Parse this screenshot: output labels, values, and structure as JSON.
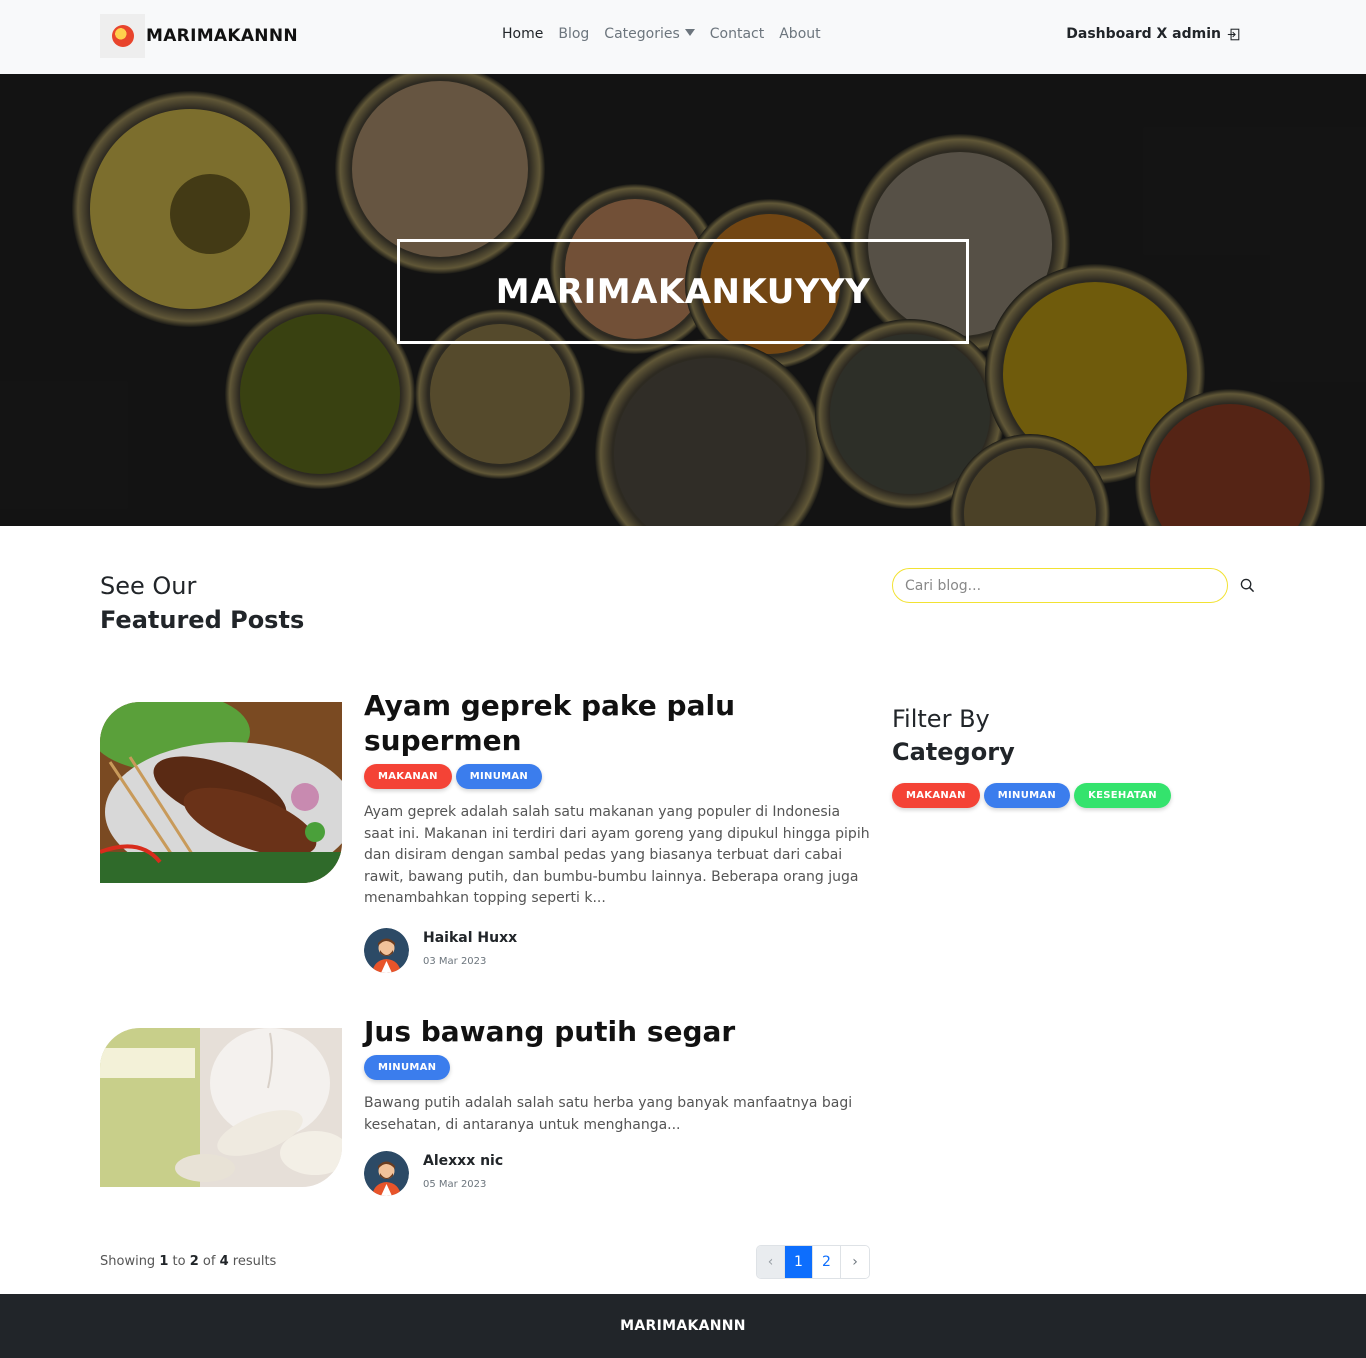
{
  "navbar": {
    "brand": "MARIMAKANNN",
    "links": [
      {
        "label": "Home",
        "active": true
      },
      {
        "label": "Blog",
        "active": false
      },
      {
        "label": "Categories",
        "active": false
      },
      {
        "label": "Contact",
        "active": false
      },
      {
        "label": "About",
        "active": false
      }
    ],
    "user_label": "Dashboard X admin"
  },
  "hero": {
    "title": "MARIMAKANKUYYY"
  },
  "featured": {
    "line1": "See Our",
    "line2": "Featured Posts"
  },
  "posts": [
    {
      "title": "Ayam geprek pake palu supermen",
      "tags": [
        "MAKANAN",
        "MINUMAN"
      ],
      "excerpt": "Ayam geprek adalah salah satu makanan yang populer di Indonesia saat ini. Makanan ini terdiri dari ayam goreng yang dipukul hingga pipih dan disiram dengan sambal pedas yang biasanya terbuat dari cabai rawit, bawang putih, dan bumbu-bumbu lainnya. Beberapa orang juga menambahkan topping seperti k...",
      "author": "Haikal Huxx",
      "date": "03 Mar 2023"
    },
    {
      "title": "Jus bawang putih segar",
      "tags": [
        "MINUMAN"
      ],
      "excerpt": "Bawang putih adalah salah satu herba yang banyak manfaatnya bagi kesehatan, di antaranya untuk menghanga...",
      "author": "Alexxx nic",
      "date": "05 Mar 2023"
    }
  ],
  "pagination": {
    "showing_prefix": "Showing",
    "from": "1",
    "to_word": "to",
    "to": "2",
    "of_word": "of",
    "total": "4",
    "results_word": "results",
    "prev": "‹",
    "pages": [
      "1",
      "2"
    ],
    "current": "1",
    "next": "›"
  },
  "sidebar": {
    "search_placeholder": "Cari blog...",
    "filter_line1": "Filter By",
    "filter_line2": "Category",
    "categories": [
      "MAKANAN",
      "MINUMAN",
      "KESEHATAN"
    ]
  },
  "footer": {
    "text": "MARIMAKANNN"
  },
  "colors": {
    "makanan": "#f44336",
    "minuman": "#3b7ded",
    "kesehatan": "#34e36d",
    "search_border": "#f2e233",
    "footer_bg": "#212529",
    "pagination_active": "#0d6efd"
  },
  "icons": {
    "brand": "food-logo-icon",
    "categories_caret": "caret-down-icon",
    "logout": "logout-icon",
    "search": "search-icon"
  }
}
